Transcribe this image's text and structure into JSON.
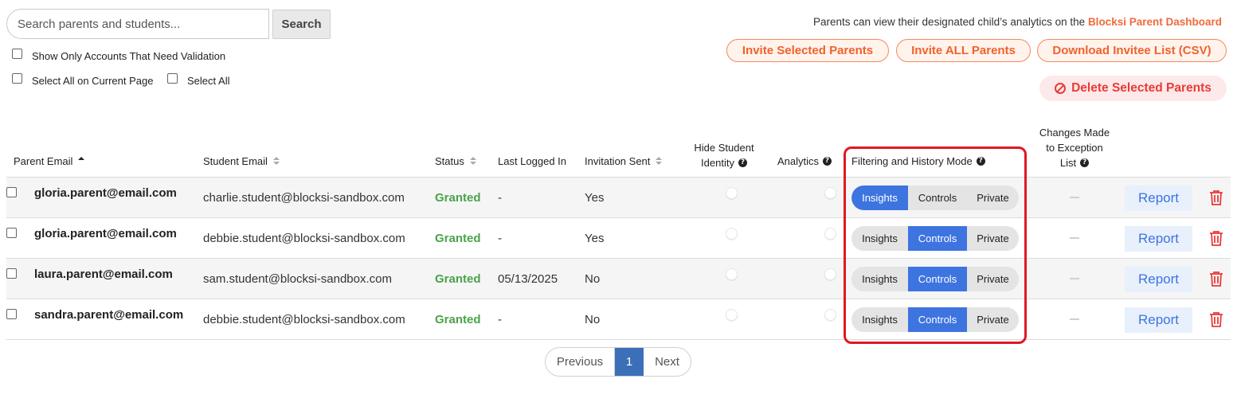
{
  "search": {
    "placeholder": "Search parents and students...",
    "button": "Search"
  },
  "filters": {
    "validation_only": "Show Only Accounts That Need Validation",
    "select_page": "Select All on Current Page",
    "select_all": "Select All"
  },
  "notice": {
    "text": "Parents can view their designated child’s analytics on the ",
    "link": "Blocksi Parent Dashboard"
  },
  "actions": {
    "invite_selected": "Invite Selected Parents",
    "invite_all": "Invite ALL Parents",
    "download": "Download Invitee List (CSV)",
    "delete_selected": "Delete Selected Parents"
  },
  "colors": {
    "accent_orange": "#f0622e",
    "primary_blue": "#3d74e0",
    "granted_green": "#4aa34a",
    "danger_red": "#ea3a3a",
    "highlight_red": "#e01822"
  },
  "table": {
    "headers": {
      "parent_email": "Parent Email",
      "student_email": "Student Email",
      "status": "Status",
      "last_logged_in": "Last Logged In",
      "invitation_sent": "Invitation Sent",
      "hide_identity_1": "Hide Student",
      "hide_identity_2": "Identity",
      "analytics": "Analytics",
      "mode": "Filtering and History Mode",
      "exceptions_1": "Changes Made",
      "exceptions_2": "to Exception",
      "exceptions_3": "List"
    },
    "mode_options": [
      "Insights",
      "Controls",
      "Private"
    ],
    "report_label": "Report",
    "rows": [
      {
        "parent": "gloria.parent@email.com",
        "student": "charlie.student@blocksi-sandbox.com",
        "status": "Granted",
        "last_login": "-",
        "invited": "Yes",
        "mode": "Insights"
      },
      {
        "parent": "gloria.parent@email.com",
        "student": "debbie.student@blocksi-sandbox.com",
        "status": "Granted",
        "last_login": "-",
        "invited": "Yes",
        "mode": "Controls"
      },
      {
        "parent": "laura.parent@email.com",
        "student": "sam.student@blocksi-sandbox.com",
        "status": "Granted",
        "last_login": "05/13/2025",
        "invited": "No",
        "mode": "Controls"
      },
      {
        "parent": "sandra.parent@email.com",
        "student": "debbie.student@blocksi-sandbox.com",
        "status": "Granted",
        "last_login": "-",
        "invited": "No",
        "mode": "Controls"
      }
    ]
  },
  "pagination": {
    "previous": "Previous",
    "current": "1",
    "next": "Next"
  }
}
